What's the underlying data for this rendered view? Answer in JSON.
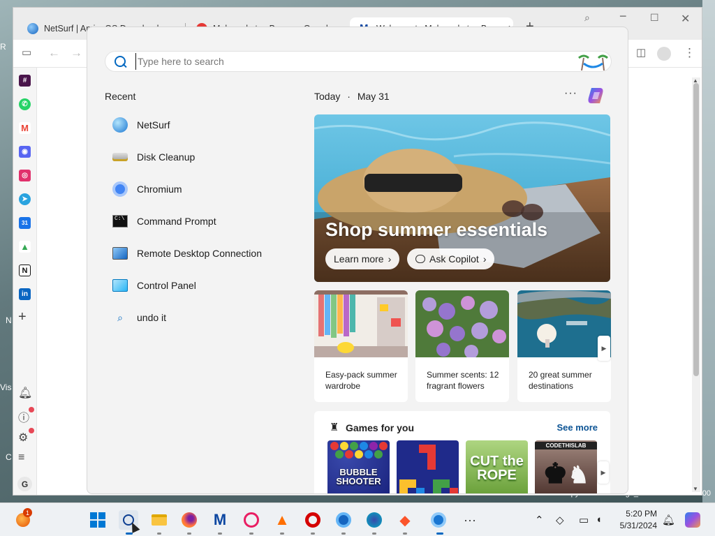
{
  "desktop": {
    "frags": [
      "R",
      "Vis",
      "N",
      "C"
    ],
    "build_text": "evaluation copy. Build 26100.ge_release.240308-1400"
  },
  "browser": {
    "tabs": [
      {
        "label": "NetSurf | AmigaOS Downloads",
        "icon": "globe-icon",
        "color": "#1e88e5"
      },
      {
        "label": "Malwarebytes Browser Guard",
        "icon": "malwarebytes-icon",
        "color": "#e53935"
      },
      {
        "label": "Welcome to Malwarebytes Bro...",
        "icon": "malwarebytes-icon",
        "color": "#0d47a1"
      }
    ],
    "sidebar_apps": [
      {
        "name": "slack-icon",
        "color": "#4a154b",
        "glyph": "#"
      },
      {
        "name": "whatsapp-icon",
        "color": "#25d366",
        "glyph": "✆"
      },
      {
        "name": "gmail-icon",
        "color": "#ea4335",
        "glyph": "M"
      },
      {
        "name": "discord-icon",
        "color": "#5865f2",
        "glyph": "◉"
      },
      {
        "name": "instagram-icon",
        "color": "#e1306c",
        "glyph": "◎"
      },
      {
        "name": "telegram-icon",
        "color": "#2aa3df",
        "glyph": "➤"
      },
      {
        "name": "calendar-icon",
        "color": "#1a73e8",
        "glyph": "31"
      },
      {
        "name": "drive-icon",
        "color": "#34a853",
        "glyph": "▲"
      },
      {
        "name": "notion-icon",
        "color": "#111111",
        "glyph": "N"
      },
      {
        "name": "linkedin-icon",
        "color": "#0a66c2",
        "glyph": "in"
      }
    ],
    "avatar_letter": "G"
  },
  "search": {
    "placeholder": "Type here to search",
    "value": ""
  },
  "recent": {
    "heading": "Recent",
    "items": [
      {
        "label": "NetSurf",
        "icon": "netsurf-icon"
      },
      {
        "label": "Disk Cleanup",
        "icon": "disk-cleanup-icon"
      },
      {
        "label": "Chromium",
        "icon": "chromium-icon"
      },
      {
        "label": "Command Prompt",
        "icon": "command-prompt-icon"
      },
      {
        "label": "Remote Desktop Connection",
        "icon": "remote-desktop-icon"
      },
      {
        "label": "Control Panel",
        "icon": "control-panel-icon"
      },
      {
        "label": "undo it",
        "icon": "search-icon"
      }
    ]
  },
  "feed": {
    "today": "Today",
    "date": "May 31",
    "hero": {
      "title": "Shop summer essentials",
      "learn_more": "Learn more",
      "ask_copilot": "Ask Copilot"
    },
    "cards": [
      {
        "caption": "Easy-pack summer wardrobe"
      },
      {
        "caption": "Summer scents: 12 fragrant flowers"
      },
      {
        "caption": "20 great summer destinations"
      }
    ],
    "games": {
      "heading": "Games for you",
      "see_more": "See more",
      "tiles": [
        {
          "title": "BUBBLE SHOOTER",
          "color": "#1e3a8a"
        },
        {
          "title": "",
          "color": "#1f2a8a"
        },
        {
          "title": "CUT the ROPE",
          "color": "#7cb342"
        },
        {
          "title": "CODETHISLAB",
          "color": "#5d4037"
        }
      ]
    }
  },
  "taskbar": {
    "badge": "1",
    "time": "5:20 PM",
    "date": "5/31/2024"
  }
}
